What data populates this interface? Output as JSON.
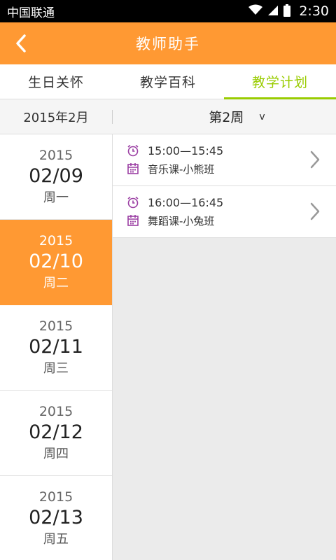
{
  "status_bar": {
    "carrier": "中国联通",
    "time": "2:30"
  },
  "header": {
    "title": "教师助手"
  },
  "tabs": [
    {
      "label": "生日关怀",
      "active": false
    },
    {
      "label": "教学百科",
      "active": false
    },
    {
      "label": "教学计划",
      "active": true
    }
  ],
  "filter": {
    "month": "2015年2月",
    "week": "第2周",
    "week_arrow": "v"
  },
  "days": [
    {
      "year": "2015",
      "date": "02/09",
      "weekday": "周一",
      "selected": false
    },
    {
      "year": "2015",
      "date": "02/10",
      "weekday": "周二",
      "selected": true
    },
    {
      "year": "2015",
      "date": "02/11",
      "weekday": "周三",
      "selected": false
    },
    {
      "year": "2015",
      "date": "02/12",
      "weekday": "周四",
      "selected": false
    },
    {
      "year": "2015",
      "date": "02/13",
      "weekday": "周五",
      "selected": false
    }
  ],
  "schedule": [
    {
      "time": "15:00—15:45",
      "course": "音乐课-小熊班"
    },
    {
      "time": "16:00—16:45",
      "course": "舞蹈课-小兔班"
    }
  ],
  "colors": {
    "accent": "#ff9933",
    "tab_active": "#99cc00",
    "icon": "#9b3fa3"
  }
}
